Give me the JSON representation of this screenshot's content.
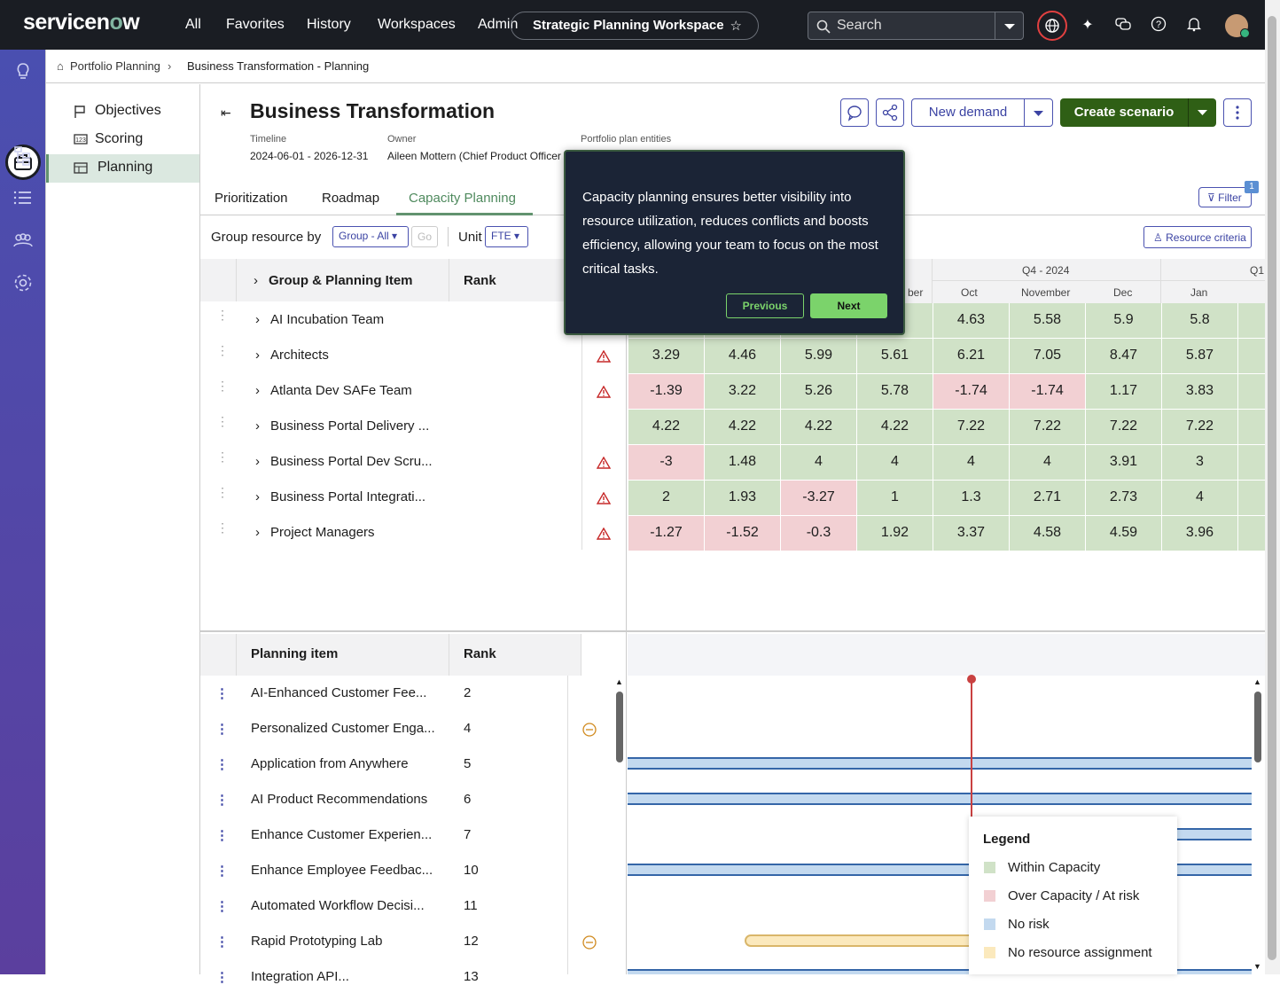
{
  "topbar": {
    "brand_left": "servicen",
    "brand_o": "o",
    "brand_right": "w",
    "nav": [
      "All",
      "Favorites",
      "History",
      "Workspaces",
      "Admin"
    ],
    "workspace_title": "Strategic Planning Workspace",
    "search_placeholder": "Search"
  },
  "breadcrumb": {
    "root": "Portfolio Planning",
    "current": "Business Transformation - Planning"
  },
  "sidenav": {
    "items": [
      {
        "label": "Objectives",
        "icon": "flag-icon"
      },
      {
        "label": "Scoring",
        "icon": "score-icon"
      },
      {
        "label": "Planning",
        "icon": "table-icon",
        "selected": true
      }
    ]
  },
  "header": {
    "title": "Business Transformation",
    "timeline_label": "Timeline",
    "timeline_value": "2024-06-01 - 2026-12-31",
    "owner_label": "Owner",
    "owner_value": "Aileen Mottern (Chief Product Officer",
    "entities_label": "Portfolio plan entities",
    "new_demand": "New demand",
    "create_scenario": "Create scenario"
  },
  "tabs": [
    "Prioritization",
    "Roadmap",
    "Capacity Planning"
  ],
  "toolbar": {
    "group_by_label": "Group resource by",
    "group_value": "Group - All",
    "go": "Go",
    "unit_label": "Unit",
    "unit_value": "FTE",
    "filter": "Filter",
    "filter_count": "1",
    "resource_criteria": "Resource criteria"
  },
  "capacity_grid": {
    "col_group": "Group & Planning Item",
    "col_rank": "Rank",
    "quarter_fragment": "ber",
    "quarter_q4": "Q4 - 2024",
    "quarter_q1": "Q1",
    "months": [
      "Oct",
      "November",
      "Dec",
      "Jan"
    ],
    "rows": [
      {
        "name": "AI Incubation Team",
        "warn": false,
        "values": [
          "",
          "",
          "",
          "3",
          "4.63",
          "5.58",
          "5.9",
          "5.8"
        ],
        "status": [
          "g",
          "g",
          "g",
          "g",
          "g",
          "g",
          "g",
          "g"
        ]
      },
      {
        "name": "Architects",
        "warn": true,
        "values": [
          "3.29",
          "4.46",
          "5.99",
          "5.61",
          "6.21",
          "7.05",
          "8.47",
          "5.87"
        ],
        "status": [
          "g",
          "g",
          "g",
          "g",
          "g",
          "g",
          "g",
          "g"
        ]
      },
      {
        "name": "Atlanta Dev SAFe Team",
        "warn": true,
        "values": [
          "-1.39",
          "3.22",
          "5.26",
          "5.78",
          "-1.74",
          "-1.74",
          "1.17",
          "3.83"
        ],
        "status": [
          "r",
          "g",
          "g",
          "g",
          "r",
          "r",
          "g",
          "g"
        ]
      },
      {
        "name": "Business Portal Delivery ...",
        "warn": false,
        "values": [
          "4.22",
          "4.22",
          "4.22",
          "4.22",
          "7.22",
          "7.22",
          "7.22",
          "7.22"
        ],
        "status": [
          "g",
          "g",
          "g",
          "g",
          "g",
          "g",
          "g",
          "g"
        ]
      },
      {
        "name": "Business Portal Dev Scru...",
        "warn": true,
        "values": [
          "-3",
          "1.48",
          "4",
          "4",
          "4",
          "4",
          "3.91",
          "3"
        ],
        "status": [
          "r",
          "g",
          "g",
          "g",
          "g",
          "g",
          "g",
          "g"
        ]
      },
      {
        "name": "Business Portal Integrati...",
        "warn": true,
        "values": [
          "2",
          "1.93",
          "-3.27",
          "1",
          "1.3",
          "2.71",
          "2.73",
          "4"
        ],
        "status": [
          "g",
          "g",
          "r",
          "g",
          "g",
          "g",
          "g",
          "g"
        ]
      },
      {
        "name": "Project Managers",
        "warn": true,
        "values": [
          "-1.27",
          "-1.52",
          "-0.3",
          "1.92",
          "3.37",
          "4.58",
          "4.59",
          "3.96"
        ],
        "status": [
          "r",
          "r",
          "r",
          "g",
          "g",
          "g",
          "g",
          "g"
        ]
      }
    ]
  },
  "planning_items": {
    "col_item": "Planning item",
    "col_rank": "Rank",
    "rows": [
      {
        "name": "AI-Enhanced Customer Fee...",
        "rank": "2"
      },
      {
        "name": "Personalized Customer Enga...",
        "rank": "4"
      },
      {
        "name": "Application from Anywhere",
        "rank": "5"
      },
      {
        "name": "AI Product Recommendations",
        "rank": "6"
      },
      {
        "name": "Enhance Customer Experien...",
        "rank": "7"
      },
      {
        "name": "Enhance Employee Feedbac...",
        "rank": "10"
      },
      {
        "name": "Automated Workflow Decisi...",
        "rank": "11"
      },
      {
        "name": "Rapid Prototyping Lab",
        "rank": "12"
      },
      {
        "name": "Integration API...",
        "rank": "13"
      }
    ]
  },
  "legend": {
    "title": "Legend",
    "items": [
      {
        "label": "Within Capacity",
        "color": "#d0e2c7"
      },
      {
        "label": "Over Capacity / At risk",
        "color": "#f2d0d3"
      },
      {
        "label": "No risk",
        "color": "#c3d9ef"
      },
      {
        "label": "No resource assignment",
        "color": "#fbe9bd"
      }
    ]
  },
  "tooltip": {
    "text": "Capacity planning ensures better visibility into resource utilization, reduces conflicts and boosts efficiency, allowing your team to focus on the most critical tasks.",
    "previous": "Previous",
    "next": "Next"
  },
  "colors": {
    "accent_green": "#2f5f15",
    "within_capacity": "#d0e2c7",
    "over_capacity": "#f2d0d3",
    "no_risk": "#c3d9ef",
    "no_assignment": "#fbe9bd"
  }
}
